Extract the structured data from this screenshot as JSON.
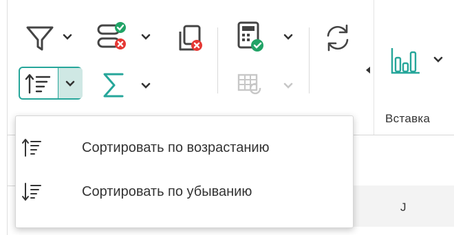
{
  "ribbon": {
    "icons": {
      "filter": "filter-icon",
      "filter_manage": "filter-manage-icon",
      "filter_clear": "filter-clear-icon",
      "sort": "sort-ascending-icon",
      "sum": "sum-icon",
      "calculate": "calculate-icon",
      "recalc_table": "recalc-table-icon",
      "refresh": "refresh-icon",
      "chart": "bar-chart-icon",
      "collapse": "collapse-arrow-icon"
    },
    "insert_group_label": "Вставка"
  },
  "sheet": {
    "column_label": "J"
  },
  "sort_menu": {
    "items": [
      {
        "label": "Сортировать по возрастанию",
        "icon": "sort-ascending-icon"
      },
      {
        "label": "Сортировать по убыванию",
        "icon": "sort-descending-icon"
      }
    ]
  },
  "colors": {
    "accent": "#26a69a",
    "accent_light": "#cfe8e4",
    "green": "#21a366",
    "red": "#e53935",
    "icon_gray": "#444444",
    "disabled": "#c7c7c7"
  }
}
